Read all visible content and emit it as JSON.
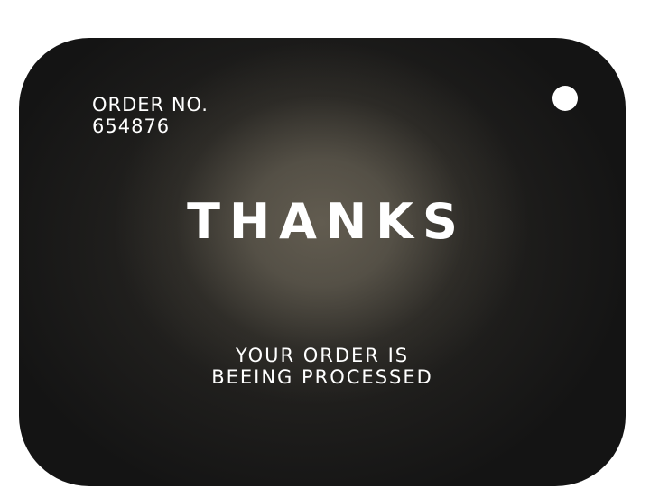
{
  "card": {
    "order_label": "ORDER NO.",
    "order_number": "654876",
    "headline": "THANKS",
    "status_line1": "YOUR ORDER IS",
    "status_line2": "BEEING PROCESSED"
  },
  "colors": {
    "background": "#ffffff",
    "card": "#141414",
    "glow": "#5e594d",
    "text": "#ffffff"
  }
}
